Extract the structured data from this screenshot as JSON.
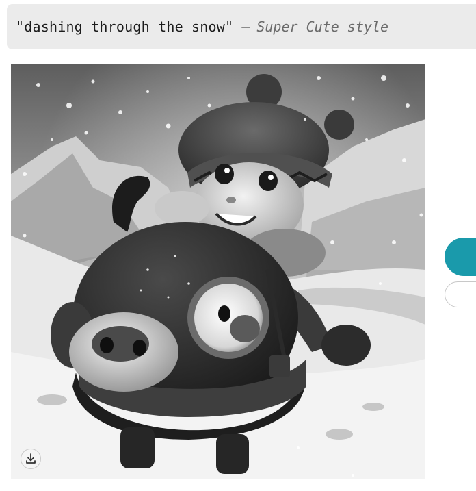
{
  "prompt": {
    "text": "\"dashing through the snow\"",
    "separator": "—",
    "style": "Super Cute style"
  },
  "image": {
    "icon": "download-icon"
  },
  "colors": {
    "prompt_bg": "#ebebeb",
    "primary_button": "#1a9aab",
    "secondary_border": "#c8c8c8"
  }
}
